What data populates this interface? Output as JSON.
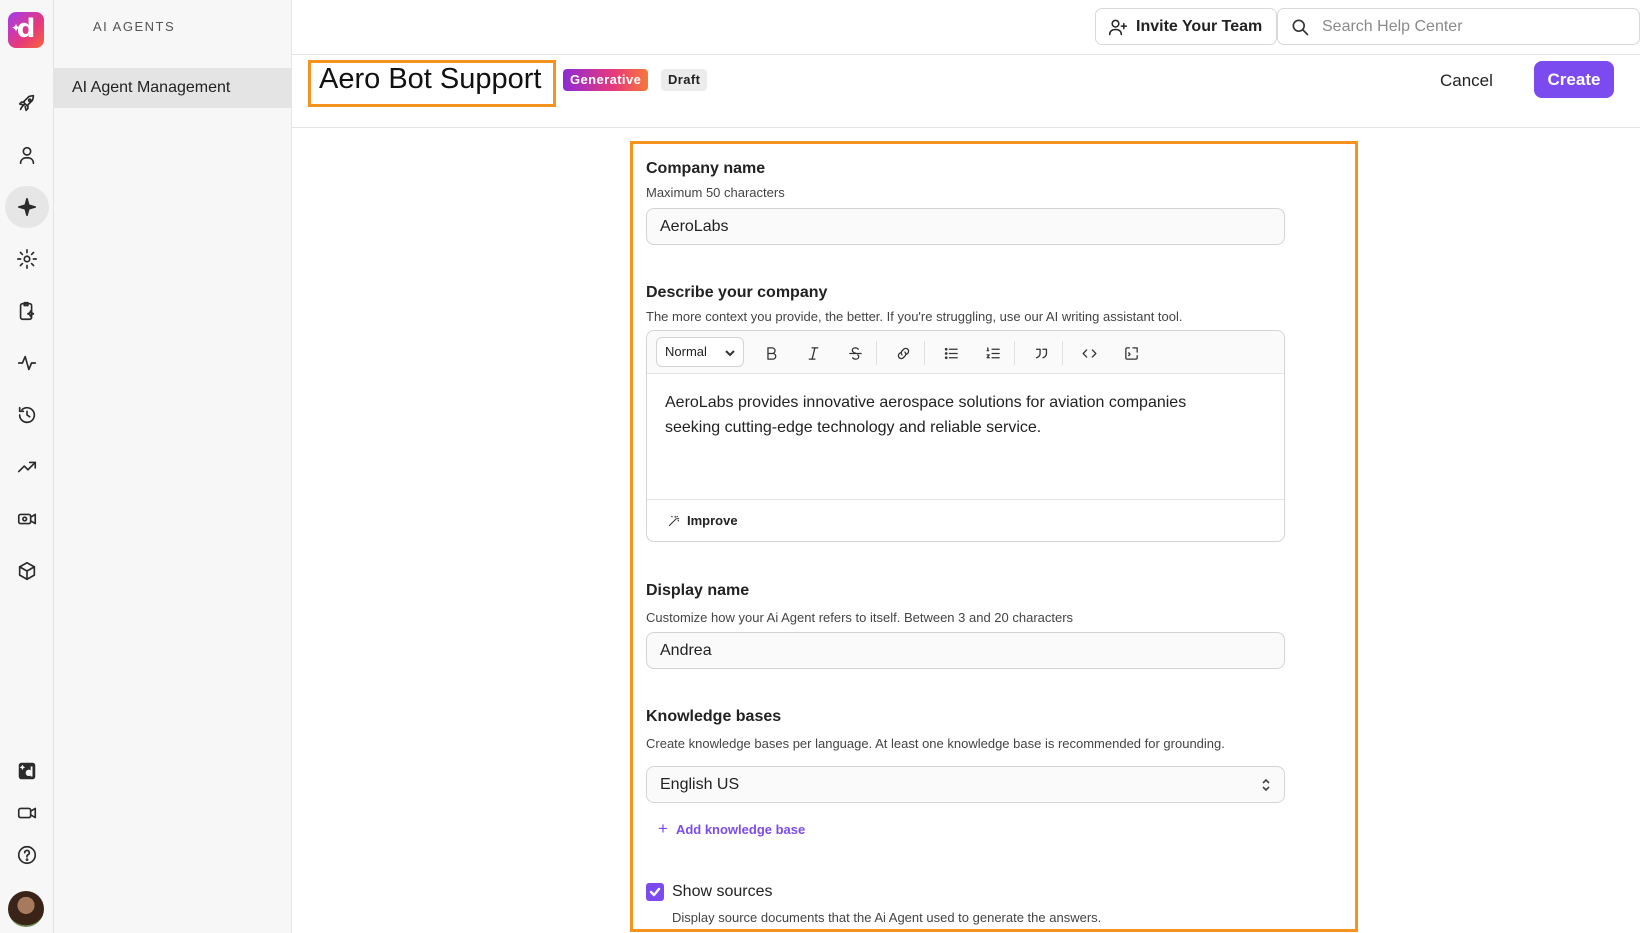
{
  "nav": {
    "section_label": "AI AGENTS",
    "active_item": "AI Agent Management"
  },
  "topbar": {
    "invite_label": "Invite Your Team",
    "search_placeholder": "Search Help Center"
  },
  "header": {
    "title": "Aero Bot Support",
    "badge_generative": "Generative",
    "badge_draft": "Draft",
    "cancel_label": "Cancel",
    "create_label": "Create"
  },
  "form": {
    "company_name": {
      "label": "Company name",
      "hint": "Maximum 50 characters",
      "value": "AeroLabs"
    },
    "describe": {
      "label": "Describe your company",
      "hint": "The more context you provide, the better. If you're struggling, use our AI writing assistant tool.",
      "format_value": "Normal",
      "value": "AeroLabs provides innovative aerospace solutions for aviation companies seeking cutting-edge technology and reliable service.",
      "improve_label": "Improve"
    },
    "display_name": {
      "label": "Display name",
      "hint": "Customize how your Ai Agent refers to itself. Between 3 and 20 characters",
      "value": "Andrea"
    },
    "knowledge_bases": {
      "label": "Knowledge bases",
      "hint": "Create knowledge bases per language. At least one knowledge base is recommended for grounding.",
      "selected": "English US",
      "add_label": "Add knowledge base"
    },
    "show_sources": {
      "label": "Show sources",
      "hint": "Display source documents that the Ai Agent used to generate the answers.",
      "checked": true
    }
  },
  "colors": {
    "accent": "#7b4bf0",
    "highlight": "#f5931e"
  }
}
